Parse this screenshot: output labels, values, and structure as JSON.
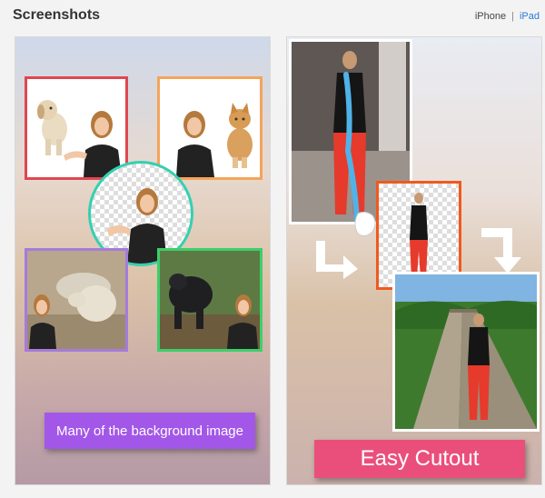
{
  "header": {
    "title": "Screenshots",
    "device_iphone": "iPhone",
    "device_separator": "|",
    "device_ipad": "iPad",
    "active_device": "iPad"
  },
  "screenshots": [
    {
      "caption": "Many of the background image",
      "caption_color": "#a357e8",
      "frame_colors": [
        "#e0474f",
        "#f4a45a",
        "#35d0b0",
        "#a57bdc",
        "#3ccf6a"
      ]
    },
    {
      "caption": "Easy Cutout",
      "caption_color": "#ea4f7c",
      "frame_colors": [
        "#ffffff",
        "#f05a1e",
        "#ffffff"
      ]
    }
  ],
  "colors": {
    "accent_link": "#2a7bd6",
    "title_text": "#333333"
  }
}
